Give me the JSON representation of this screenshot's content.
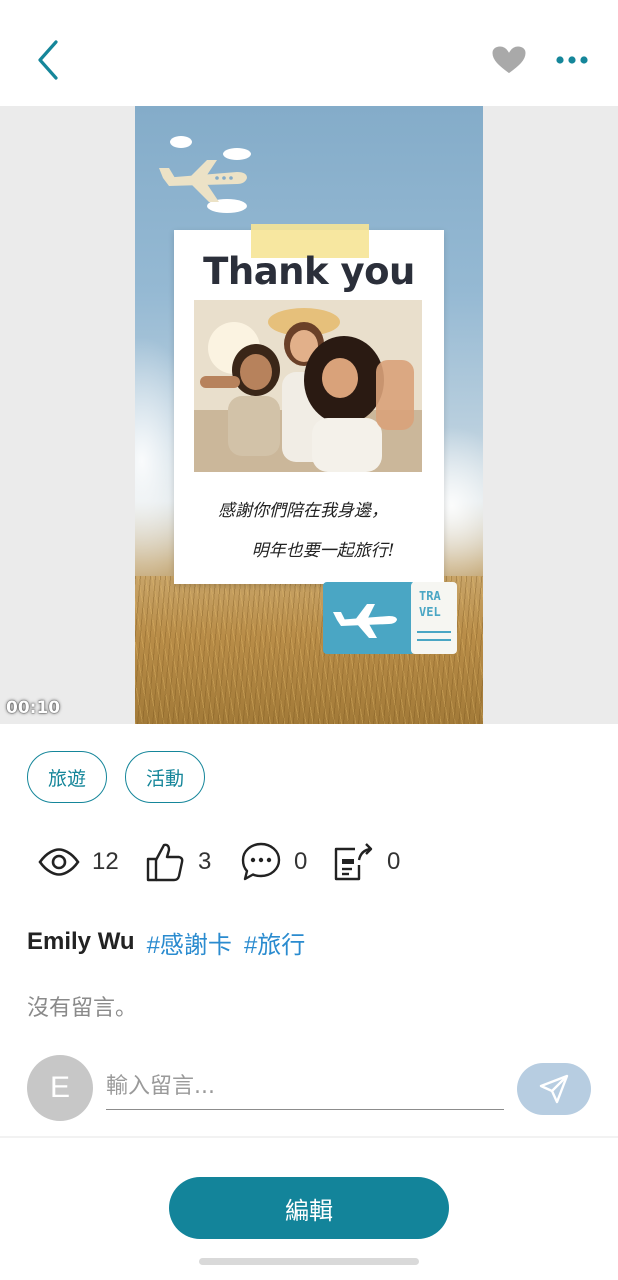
{
  "header": {
    "back_icon": "chevron-left-icon",
    "favorite_icon": "heart-icon",
    "more_icon": "more-horizontal-icon",
    "accent_color": "#15869a"
  },
  "media": {
    "card_title": "Thank you",
    "card_message_line1": "感謝你們陪在我身邊，",
    "card_message_line2": "明年也要一起旅行!",
    "ticket_text_line1": "TRA",
    "ticket_text_line2": "VEL",
    "timecode": "00:10"
  },
  "tags": [
    "旅遊",
    "活動"
  ],
  "stats": {
    "views": "12",
    "likes": "3",
    "comments": "0",
    "shares": "0"
  },
  "post": {
    "author": "Emily Wu",
    "hashtags": [
      "#感謝卡",
      "#旅行"
    ]
  },
  "comments": {
    "empty_text": "沒有留言。",
    "avatar_initial": "E",
    "input_placeholder": "輸入留言...",
    "send_icon": "send-icon"
  },
  "footer": {
    "edit_label": "編輯",
    "button_color": "#13849a"
  }
}
